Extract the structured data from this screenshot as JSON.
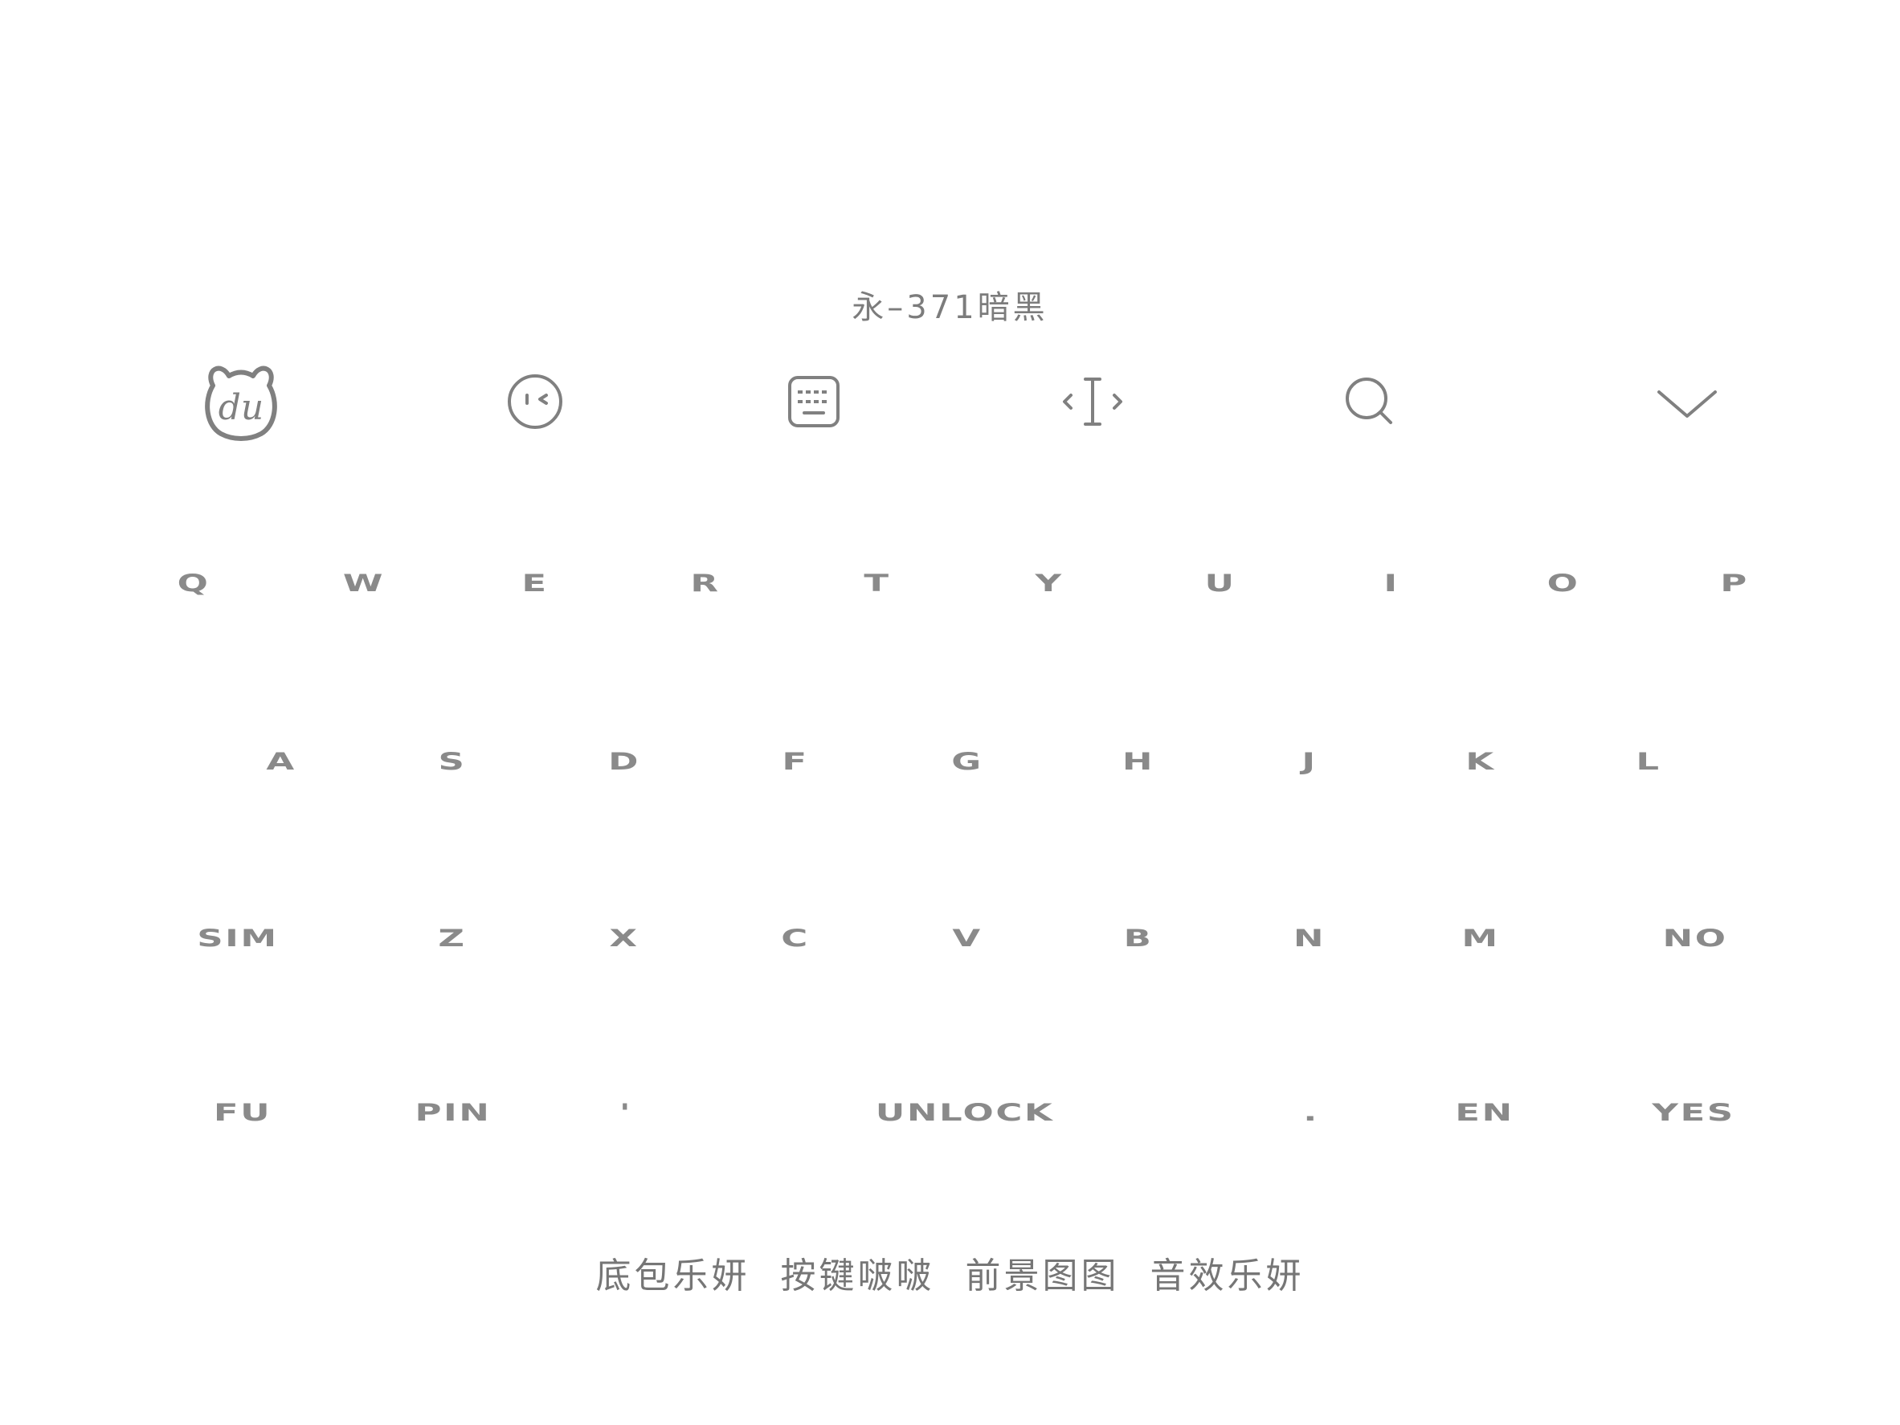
{
  "theme_title": "永–371暗黑",
  "toolbar": {
    "icons": [
      "du-bear-logo-icon",
      "emoji-face-icon",
      "keyboard-icon",
      "cursor-move-icon",
      "search-icon",
      "chevron-down-icon"
    ]
  },
  "keyboard": {
    "row1": [
      "Q",
      "W",
      "E",
      "R",
      "T",
      "Y",
      "U",
      "I",
      "O",
      "P"
    ],
    "row2": [
      "A",
      "S",
      "D",
      "F",
      "G",
      "H",
      "J",
      "K",
      "L"
    ],
    "row3": [
      "SIM",
      "Z",
      "X",
      "C",
      "V",
      "B",
      "N",
      "M",
      "NO"
    ],
    "row4": [
      "FU",
      "PIN",
      "'",
      "UNLOCK",
      ".",
      "EN",
      "YES"
    ]
  },
  "footer_text": "底包乐妍 按键啵啵 前景图图 音效乐妍",
  "colors": {
    "background": "#ffffff",
    "text": "#8a8a8a",
    "icon": "#808080"
  }
}
